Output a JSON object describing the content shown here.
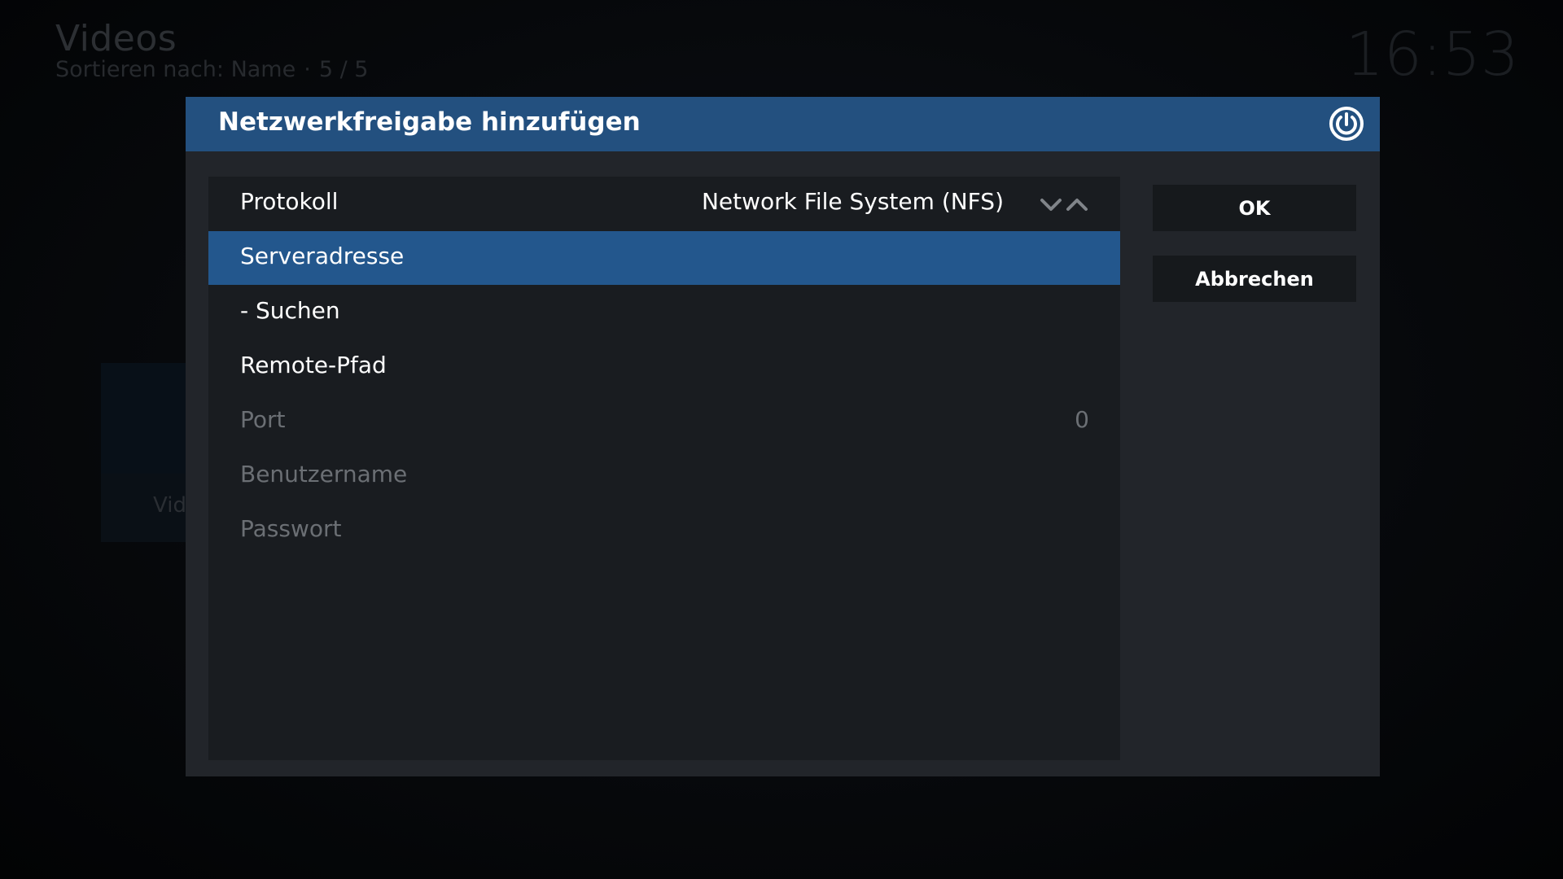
{
  "background": {
    "title": "Videos",
    "subtitle_sort": "Sortieren nach: Name",
    "subtitle_separator": "·",
    "subtitle_count": "5 / 5",
    "clock": "16:53",
    "tile_label": "Vid"
  },
  "dialog": {
    "title": "Netzwerkfreigabe hinzufügen",
    "close_icon": "kodi-close-icon",
    "header_color": "#23507f",
    "focus_color": "#23578d",
    "rows": [
      {
        "label": "Protokoll",
        "value": "Network File System (NFS)",
        "state": "normal",
        "spinner": true
      },
      {
        "label": "Serveradresse",
        "value": "",
        "state": "focused"
      },
      {
        "label": "- Suchen",
        "value": "",
        "state": "normal"
      },
      {
        "label": "Remote-Pfad",
        "value": "",
        "state": "normal"
      },
      {
        "label": "Port",
        "value": "0",
        "state": "disabled"
      },
      {
        "label": "Benutzername",
        "value": "",
        "state": "disabled"
      },
      {
        "label": "Passwort",
        "value": "",
        "state": "disabled"
      }
    ],
    "buttons": {
      "ok_label": "OK",
      "cancel_label": "Abbrechen"
    }
  }
}
